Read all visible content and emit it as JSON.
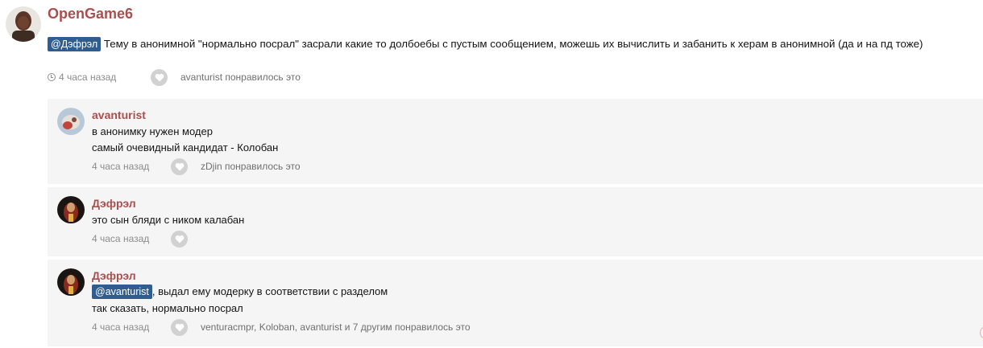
{
  "post": {
    "author": "OpenGame6",
    "mention": "@Дэфрэл",
    "text": " Тему в анонимной \"нормально посрал\" засрали какие то долбоебы с пустым сообщением, можешь их вычислить и забанить к херам в анонимной (да и на пд тоже)",
    "time": "4 часа назад",
    "likes": "avanturist понравилось это"
  },
  "replies": [
    {
      "author": "avanturist",
      "lines": [
        "в анонимку нужен модер",
        "самый очевидный кандидат - Колобан"
      ],
      "time": "4 часа назад",
      "likes": "zDjin понравилось это"
    },
    {
      "author": "Дэфрэл",
      "lines": [
        "это сын бляди с ником калабан"
      ],
      "time": "4 часа назад",
      "likes": ""
    },
    {
      "author": "Дэфрэл",
      "mention": "@avanturist",
      "lines": [
        ", выдал ему модерку в соответствии с разделом",
        "так сказать, нормально посрал"
      ],
      "time": "4 часа назад",
      "likes": "venturacmpr, Koloban, avanturist и 7 другим понравилось это"
    }
  ],
  "colors": {
    "author": "#a8504f",
    "mention_bg": "#2f5d8f",
    "reply_bg": "#f5f5f5",
    "meta": "#8c8c8c"
  },
  "icons": [
    "clock-icon",
    "heart-icon"
  ]
}
